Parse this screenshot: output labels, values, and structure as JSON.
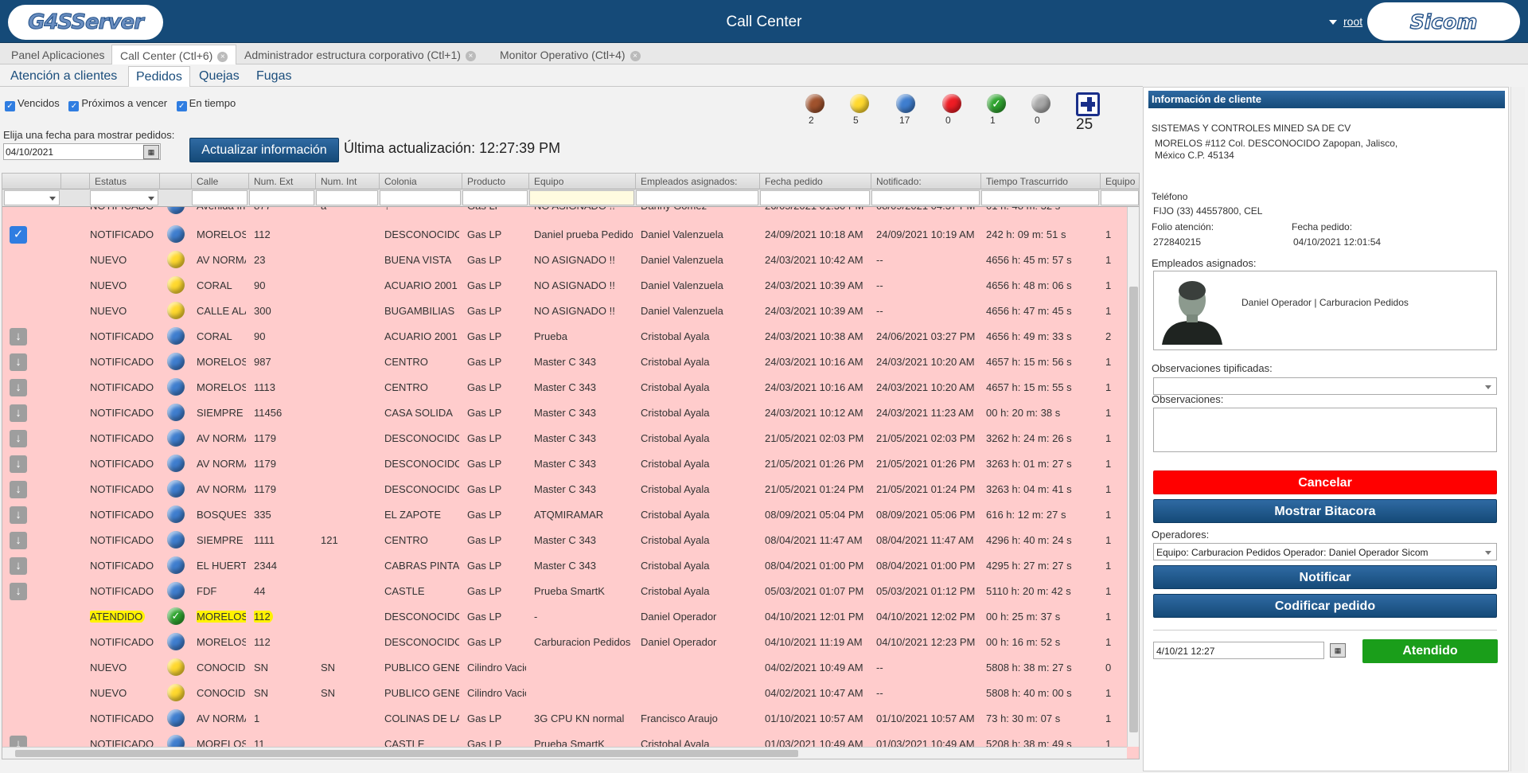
{
  "header": {
    "logo_left": "G4SServer",
    "title": "Call Center",
    "user": "root",
    "logo_right": "Sicom"
  },
  "app_tabs": [
    {
      "label": "Panel Aplicaciones",
      "closable": false
    },
    {
      "label": "Call Center (Ctl+6)",
      "closable": true
    },
    {
      "label": "Administrador estructura corporativo (Ctl+1)",
      "closable": true
    },
    {
      "label": "Monitor Operativo (Ctl+4)",
      "closable": true
    }
  ],
  "sub_tabs": [
    "Atención a clientes",
    "Pedidos",
    "Quejas",
    "Fugas"
  ],
  "filters": [
    "Vencidos",
    "Próximos a vencer",
    "En tiempo"
  ],
  "legend": {
    "brown": "2",
    "yellow": "5",
    "blue": "17",
    "red": "0",
    "green": "1",
    "gray": "0",
    "total": "25",
    "colors": {
      "brown": "#a0522d",
      "yellow": "#ffd92e",
      "blue": "#3f7ecf",
      "red": "#ee1c24",
      "green": "#2fa52f",
      "gray": "#a8a8a8"
    }
  },
  "date_prompt": "Elija una fecha para mostrar pedidos:",
  "date_value": "04/10/2021",
  "update_button": "Actualizar información",
  "last_update": "Última actualización: 12:27:39 PM",
  "columns": [
    "Estatus",
    "Calle",
    "Num. Ext",
    "Num. Int",
    "Colonia",
    "Producto",
    "Equipo",
    "Empleados asignados:",
    "Fecha pedido",
    "Notificado:",
    "Tiempo Trascurrido",
    "Equipo"
  ],
  "rows": [
    {
      "icon": "none",
      "estatus": "NOTIFICADO",
      "ball": "blue",
      "calle": "Avenida In",
      "ext": "877",
      "int": "a",
      "colonia": "?",
      "producto": "Gas LP",
      "equipo": "NO ASIGNADO !!",
      "empleados": "Danny Gómez",
      "fecha": "26/05/2021 01:30 PM",
      "notificado": "08/09/2021 04:37 PM",
      "tiempo": "01 h: 48 m: 32 s",
      "eq": ""
    },
    {
      "icon": "check",
      "estatus": "NOTIFICADO",
      "ball": "blue",
      "calle": "MORELOS",
      "ext": "112",
      "int": "",
      "colonia": "DESCONOCIDO",
      "producto": "Gas LP",
      "equipo": "Daniel prueba Pedidos",
      "empleados": "Daniel Valenzuela",
      "fecha": "24/09/2021 10:18 AM",
      "notificado": "24/09/2021 10:19 AM",
      "tiempo": "242 h: 09 m: 51 s",
      "eq": "1"
    },
    {
      "icon": "none",
      "estatus": "NUEVO",
      "ball": "yellow",
      "calle": "AV NORMA",
      "ext": "23",
      "int": "",
      "colonia": "BUENA VISTA",
      "producto": "Gas LP",
      "equipo": "NO ASIGNADO !!",
      "empleados": "Daniel Valenzuela",
      "fecha": "24/03/2021 10:42 AM",
      "notificado": "--",
      "tiempo": "4656 h: 45 m: 57 s",
      "eq": "1"
    },
    {
      "icon": "none",
      "estatus": "NUEVO",
      "ball": "yellow",
      "calle": "CORAL",
      "ext": "90",
      "int": "",
      "colonia": "ACUARIO 2001",
      "producto": "Gas LP",
      "equipo": "NO ASIGNADO !!",
      "empleados": "Daniel Valenzuela",
      "fecha": "24/03/2021 10:39 AM",
      "notificado": "--",
      "tiempo": "4656 h: 48 m: 06 s",
      "eq": "1"
    },
    {
      "icon": "none",
      "estatus": "NUEVO",
      "ball": "yellow",
      "calle": "CALLE ALA",
      "ext": "300",
      "int": "",
      "colonia": "BUGAMBILIAS",
      "producto": "Gas LP",
      "equipo": "NO ASIGNADO !!",
      "empleados": "Daniel Valenzuela",
      "fecha": "24/03/2021 10:39 AM",
      "notificado": "--",
      "tiempo": "4656 h: 47 m: 45 s",
      "eq": "1"
    },
    {
      "icon": "down",
      "estatus": "NOTIFICADO",
      "ball": "blue",
      "calle": "CORAL",
      "ext": "90",
      "int": "",
      "colonia": "ACUARIO 2001",
      "producto": "Gas LP",
      "equipo": "Prueba",
      "empleados": "Cristobal Ayala",
      "fecha": "24/03/2021 10:38 AM",
      "notificado": "24/06/2021 03:27 PM",
      "tiempo": "4656 h: 49 m: 33 s",
      "eq": "2"
    },
    {
      "icon": "down",
      "estatus": "NOTIFICADO",
      "ball": "blue",
      "calle": "MORELOS",
      "ext": "987",
      "int": "",
      "colonia": "CENTRO",
      "producto": "Gas LP",
      "equipo": "Master C 343",
      "empleados": "Cristobal Ayala",
      "fecha": "24/03/2021 10:16 AM",
      "notificado": "24/03/2021 10:20 AM",
      "tiempo": "4657 h: 15 m: 56 s",
      "eq": "1"
    },
    {
      "icon": "down",
      "estatus": "NOTIFICADO",
      "ball": "blue",
      "calle": "MORELOS",
      "ext": "1113",
      "int": "",
      "colonia": "CENTRO",
      "producto": "Gas LP",
      "equipo": "Master C 343",
      "empleados": "Cristobal Ayala",
      "fecha": "24/03/2021 10:16 AM",
      "notificado": "24/03/2021 10:20 AM",
      "tiempo": "4657 h: 15 m: 55 s",
      "eq": "1"
    },
    {
      "icon": "down",
      "estatus": "NOTIFICADO",
      "ball": "blue",
      "calle": "SIEMPRE V",
      "ext": "11456",
      "int": "",
      "colonia": "CASA SOLIDA",
      "producto": "Gas LP",
      "equipo": "Master C 343",
      "empleados": "Cristobal Ayala",
      "fecha": "24/03/2021 10:12 AM",
      "notificado": "24/03/2021 11:23 AM",
      "tiempo": "00 h: 20 m: 38 s",
      "eq": "1"
    },
    {
      "icon": "down",
      "estatus": "NOTIFICADO",
      "ball": "blue",
      "calle": "AV NORMA",
      "ext": "1179",
      "int": "",
      "colonia": "DESCONOCIDO",
      "producto": "Gas LP",
      "equipo": "Master C 343",
      "empleados": "Cristobal Ayala",
      "fecha": "21/05/2021 02:03 PM",
      "notificado": "21/05/2021 02:03 PM",
      "tiempo": "3262 h: 24 m: 26 s",
      "eq": "1"
    },
    {
      "icon": "down",
      "estatus": "NOTIFICADO",
      "ball": "blue",
      "calle": "AV NORMA",
      "ext": "1179",
      "int": "",
      "colonia": "DESCONOCIDO",
      "producto": "Gas LP",
      "equipo": "Master C 343",
      "empleados": "Cristobal Ayala",
      "fecha": "21/05/2021 01:26 PM",
      "notificado": "21/05/2021 01:26 PM",
      "tiempo": "3263 h: 01 m: 27 s",
      "eq": "1"
    },
    {
      "icon": "down",
      "estatus": "NOTIFICADO",
      "ball": "blue",
      "calle": "AV NORMA",
      "ext": "1179",
      "int": "",
      "colonia": "DESCONOCIDO",
      "producto": "Gas LP",
      "equipo": "Master C 343",
      "empleados": "Cristobal Ayala",
      "fecha": "21/05/2021 01:24 PM",
      "notificado": "21/05/2021 01:24 PM",
      "tiempo": "3263 h: 04 m: 41 s",
      "eq": "1"
    },
    {
      "icon": "down",
      "estatus": "NOTIFICADO",
      "ball": "blue",
      "calle": "BOSQUES",
      "ext": "335",
      "int": "",
      "colonia": "EL ZAPOTE",
      "producto": "Gas LP",
      "equipo": "ATQMIRAMAR",
      "empleados": "Cristobal Ayala",
      "fecha": "08/09/2021 05:04 PM",
      "notificado": "08/09/2021 05:06 PM",
      "tiempo": "616 h: 12 m: 27 s",
      "eq": "1"
    },
    {
      "icon": "down",
      "estatus": "NOTIFICADO",
      "ball": "blue",
      "calle": "SIEMPRE V",
      "ext": "1111",
      "int": "121",
      "colonia": "CENTRO",
      "producto": "Gas LP",
      "equipo": "Master C 343",
      "empleados": "Cristobal Ayala",
      "fecha": "08/04/2021 11:47 AM",
      "notificado": "08/04/2021 11:47 AM",
      "tiempo": "4296 h: 40 m: 24 s",
      "eq": "1"
    },
    {
      "icon": "down",
      "estatus": "NOTIFICADO",
      "ball": "blue",
      "calle": "EL HUERTO",
      "ext": "2344",
      "int": "",
      "colonia": "CABRAS PINTAS",
      "producto": "Gas LP",
      "equipo": "Master C 343",
      "empleados": "Cristobal Ayala",
      "fecha": "08/04/2021 01:00 PM",
      "notificado": "08/04/2021 01:00 PM",
      "tiempo": "4295 h: 27 m: 27 s",
      "eq": "1"
    },
    {
      "icon": "down",
      "estatus": "NOTIFICADO",
      "ball": "blue",
      "calle": "FDF",
      "ext": "44",
      "int": "",
      "colonia": "CASTLE",
      "producto": "Gas LP",
      "equipo": "Prueba SmartK",
      "empleados": "Cristobal Ayala",
      "fecha": "05/03/2021 01:07 PM",
      "notificado": "05/03/2021 01:12 PM",
      "tiempo": "5110 h: 20 m: 42 s",
      "eq": "1"
    },
    {
      "icon": "none",
      "estatus": "ATENDIDO",
      "ball": "green",
      "calle": "MORELOS",
      "ext": "112",
      "int": "",
      "colonia": "DESCONOCIDO",
      "producto": "Gas LP",
      "equipo": "-",
      "empleados": "Daniel Operador",
      "fecha": "04/10/2021 12:01 PM",
      "notificado": "04/10/2021 12:02 PM",
      "tiempo": "00 h: 25 m: 37 s",
      "eq": "1",
      "highlight": true
    },
    {
      "icon": "none",
      "estatus": "NOTIFICADO",
      "ball": "blue",
      "calle": "MORELOS",
      "ext": "112",
      "int": "",
      "colonia": "DESCONOCIDO",
      "producto": "Gas LP",
      "equipo": "Carburacion Pedidos",
      "empleados": "Daniel Operador",
      "fecha": "04/10/2021 11:19 AM",
      "notificado": "04/10/2021 12:23 PM",
      "tiempo": "00 h: 16 m: 52 s",
      "eq": "1"
    },
    {
      "icon": "none",
      "estatus": "NUEVO",
      "ball": "yellow",
      "calle": "CONOCIDO",
      "ext": "SN",
      "int": "SN",
      "colonia": "PUBLICO GENERAL",
      "producto": "Cilindro Vacio",
      "equipo": "",
      "empleados": "",
      "fecha": "04/02/2021 10:49 AM",
      "notificado": "--",
      "tiempo": "5808 h: 38 m: 27 s",
      "eq": "0"
    },
    {
      "icon": "none",
      "estatus": "NUEVO",
      "ball": "yellow",
      "calle": "CONOCIDO",
      "ext": "SN",
      "int": "SN",
      "colonia": "PUBLICO GENERAL",
      "producto": "Cilindro Vacio",
      "equipo": "",
      "empleados": "",
      "fecha": "04/02/2021 10:47 AM",
      "notificado": "--",
      "tiempo": "5808 h: 40 m: 00 s",
      "eq": "1"
    },
    {
      "icon": "none",
      "estatus": "NOTIFICADO",
      "ball": "blue",
      "calle": "AV NORMA",
      "ext": "1",
      "int": "",
      "colonia": "COLINAS DE LA",
      "producto": "Gas LP",
      "equipo": "3G CPU KN normal",
      "empleados": "Francisco Araujo",
      "fecha": "01/10/2021 10:57 AM",
      "notificado": "01/10/2021 10:57 AM",
      "tiempo": "73 h: 30 m: 07 s",
      "eq": "1"
    },
    {
      "icon": "down",
      "estatus": "NOTIFICADO",
      "ball": "blue",
      "calle": "MORELOS",
      "ext": "11",
      "int": "",
      "colonia": "CASTLE",
      "producto": "Gas LP",
      "equipo": "Prueba SmartK",
      "empleados": "Cristobal Ayala",
      "fecha": "01/03/2021 10:49 AM",
      "notificado": "01/03/2021 10:49 AM",
      "tiempo": "5208 h: 38 m: 49 s",
      "eq": "1"
    }
  ],
  "panel": {
    "title": "Información de cliente",
    "company": "SISTEMAS Y CONTROLES MINED SA DE CV",
    "address1": "MORELOS #112 Col. DESCONOCIDO Zapopan, Jalisco,",
    "address2": "México C.P. 45134",
    "phone_label": "Teléfono",
    "phone_value": "FIJO (33) 44557800, CEL",
    "folio_label": "Folio atención:",
    "folio_value": "272840215",
    "fecha_label": "Fecha pedido:",
    "fecha_value": "04/10/2021 12:01:54",
    "empleados_label": "Empleados asignados:",
    "empleado": "Daniel Operador | Carburacion Pedidos",
    "obs_tip_label": "Observaciones tipificadas:",
    "obs_label": "Observaciones:",
    "cancel": "Cancelar",
    "bitacora": "Mostrar Bitacora",
    "operadores_label": "Operadores:",
    "operador_value": "Equipo: Carburacion Pedidos Operador: Daniel Operador Sicom",
    "notificar": "Notificar",
    "codificar": "Codificar pedido",
    "datetime": "4/10/21 12:27",
    "atendido": "Atendido"
  }
}
